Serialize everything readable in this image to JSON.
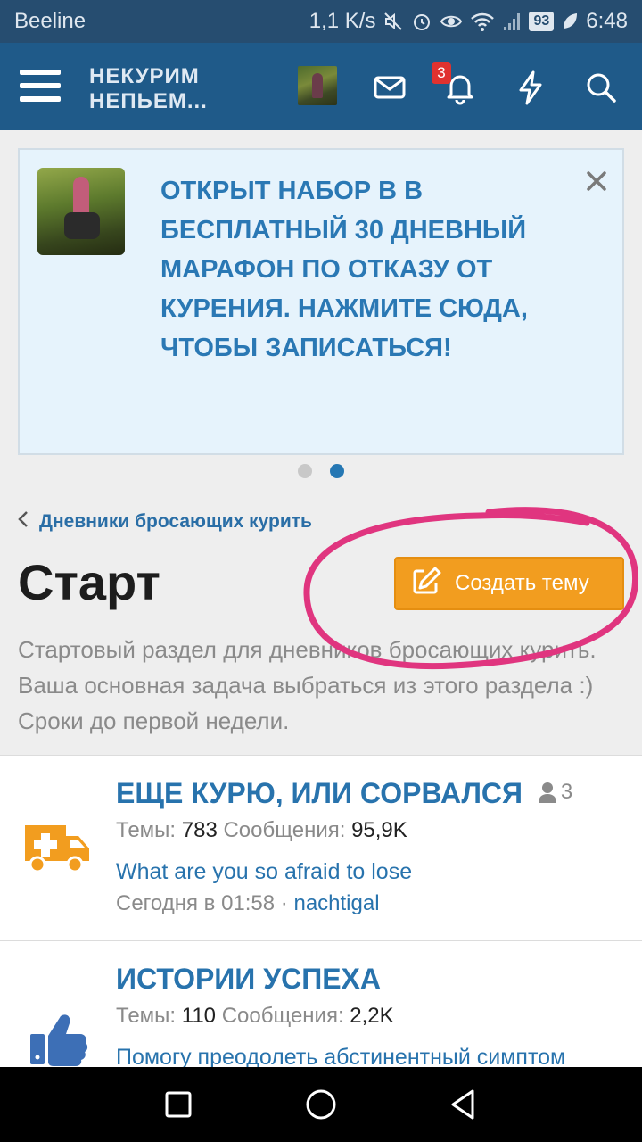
{
  "status_bar": {
    "carrier": "Beeline",
    "speed": "1,1 K/s",
    "battery": "93",
    "time": "6:48"
  },
  "header": {
    "logo_line1": "НЕКУРИМ",
    "logo_line2": "НЕПЬЕМ...",
    "notifications_count": "3",
    "icons": [
      "menu-icon",
      "user-avatar",
      "mail-icon",
      "bell-icon",
      "bolt-icon",
      "search-icon"
    ]
  },
  "notice": {
    "text": "ОТКРЫТ НАБОР В В БЕСПЛАТНЫЙ 30 ДНЕВНЫЙ МАРАФОН ПО ОТКАЗУ ОТ КУРЕНИЯ. НАЖМИТЕ СЮДА, ЧТОБЫ ЗАПИСАТЬСЯ!",
    "close_icon": "close-icon",
    "slides": 2,
    "active_slide": 2
  },
  "breadcrumb": {
    "label": "Дневники бросающих курить"
  },
  "page": {
    "title": "Старт",
    "create_button": "Создать тему",
    "description": "Стартовый раздел для дневников бросающих курить. Ваша основная задача выбраться из этого раздела :) Сроки до первой недели."
  },
  "forums": [
    {
      "title": "ЕЩЕ КУРЮ, ИЛИ СОРВАЛСЯ",
      "users_online": "3",
      "threads_label": "Темы:",
      "threads": "783",
      "posts_label": "Сообщения:",
      "posts": "95,9K",
      "last_thread": "What are you so afraid to lose",
      "last_time": "Сегодня в 01:58",
      "separator": "·",
      "last_user": "nachtigal",
      "icon": "ambulance-icon",
      "icon_color": "#f29d1f"
    },
    {
      "title": "ИСТОРИИ УСПЕХА",
      "threads_label": "Темы:",
      "threads": "110",
      "posts_label": "Сообщения:",
      "posts": "2,2K",
      "last_thread": "Помогу преодолеть абстинентный симптом",
      "icon": "thumbs-up-icon",
      "icon_color": "#3d6fb6"
    }
  ],
  "colors": {
    "header_bg": "#1f5a89",
    "accent_blue": "#2873ad",
    "button_orange": "#f29d1f",
    "annotation_pink": "#e0357f"
  }
}
